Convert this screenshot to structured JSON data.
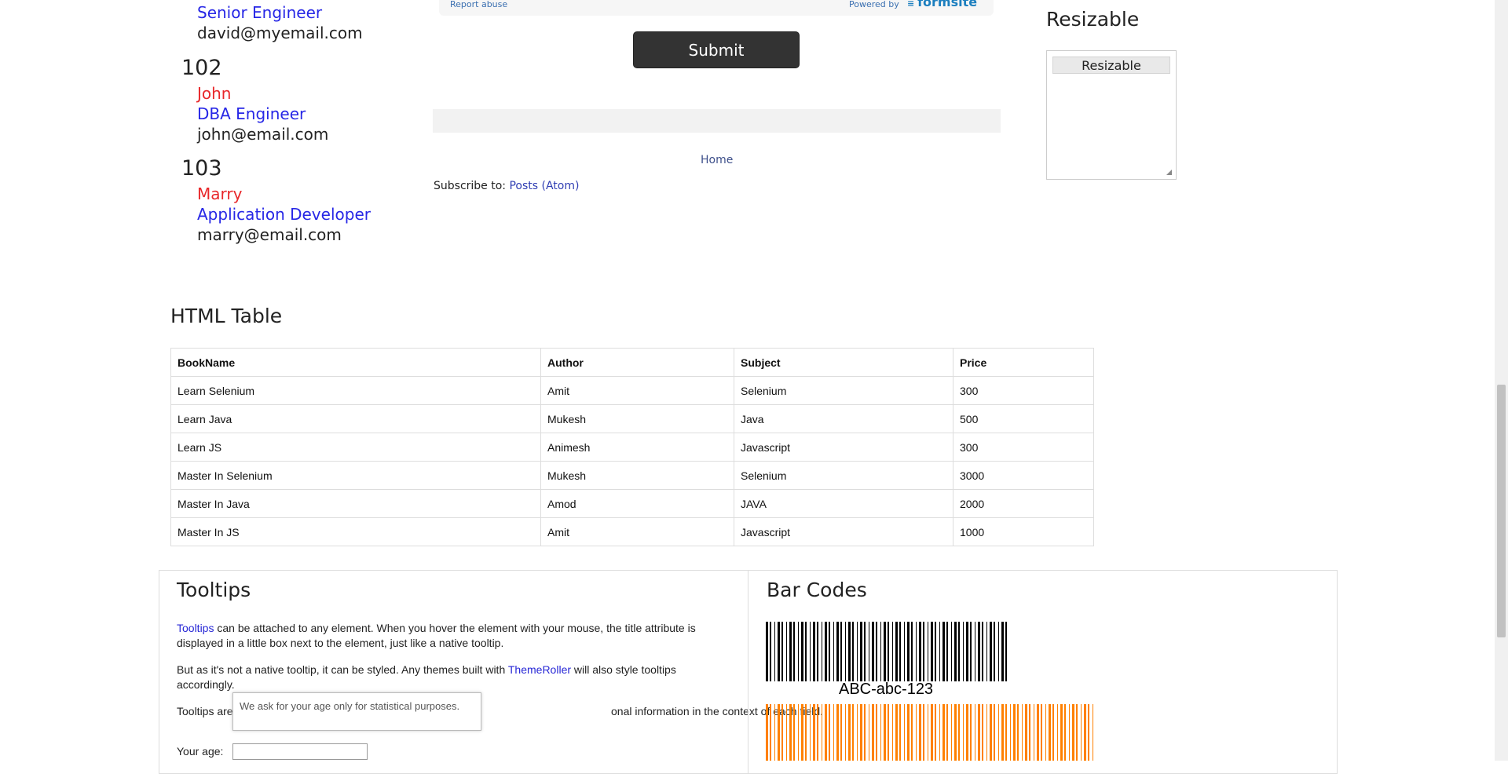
{
  "employees": [
    {
      "id": "",
      "name": "",
      "title": "Senior Engineer",
      "email": "david@myemail.com"
    },
    {
      "id": "102",
      "name": "John",
      "title": "DBA Engineer",
      "email": "john@email.com"
    },
    {
      "id": "103",
      "name": "Marry",
      "title": "Application Developer",
      "email": "marry@email.com"
    }
  ],
  "form": {
    "report_abuse": "Report abuse",
    "powered_by": "Powered by",
    "formsite": "formsite",
    "submit_label": "Submit"
  },
  "blog": {
    "home_link": "Home",
    "subscribe_prefix": "Subscribe to:",
    "subscribe_link": "Posts (Atom)"
  },
  "resizable": {
    "title": "Resizable",
    "header": "Resizable"
  },
  "html_table": {
    "title": "HTML Table",
    "headers": [
      "BookName",
      "Author",
      "Subject",
      "Price"
    ],
    "rows": [
      [
        "Learn Selenium",
        "Amit",
        "Selenium",
        "300"
      ],
      [
        "Learn Java",
        "Mukesh",
        "Java",
        "500"
      ],
      [
        "Learn JS",
        "Animesh",
        "Javascript",
        "300"
      ],
      [
        "Master In Selenium",
        "Mukesh",
        "Selenium",
        "3000"
      ],
      [
        "Master In Java",
        "Amod",
        "JAVA",
        "2000"
      ],
      [
        "Master In JS",
        "Amit",
        "Javascript",
        "1000"
      ]
    ]
  },
  "tooltips": {
    "title": "Tooltips",
    "p1_link": "Tooltips",
    "p1_rest": " can be attached to any element. When you hover the element with your mouse, the title attribute is displayed in a little box next to the element, just like a native tooltip.",
    "p2_prefix": "But as it's not a native tooltip, it can be styled. Any themes built with ",
    "p2_link": "ThemeRoller",
    "p2_suffix": " will also style tooltips accordingly.",
    "p3_start": "Tooltips are",
    "p3_end": "onal information in the context of each field.",
    "popup_text": "We ask for your age only for statistical purposes.",
    "age_label": "Your age:",
    "age_value": ""
  },
  "barcodes": {
    "title": "Bar Codes",
    "code_text": "ABC-abc-123",
    "colors": {
      "primary": "#000000",
      "secondary": "#ff8000"
    }
  }
}
